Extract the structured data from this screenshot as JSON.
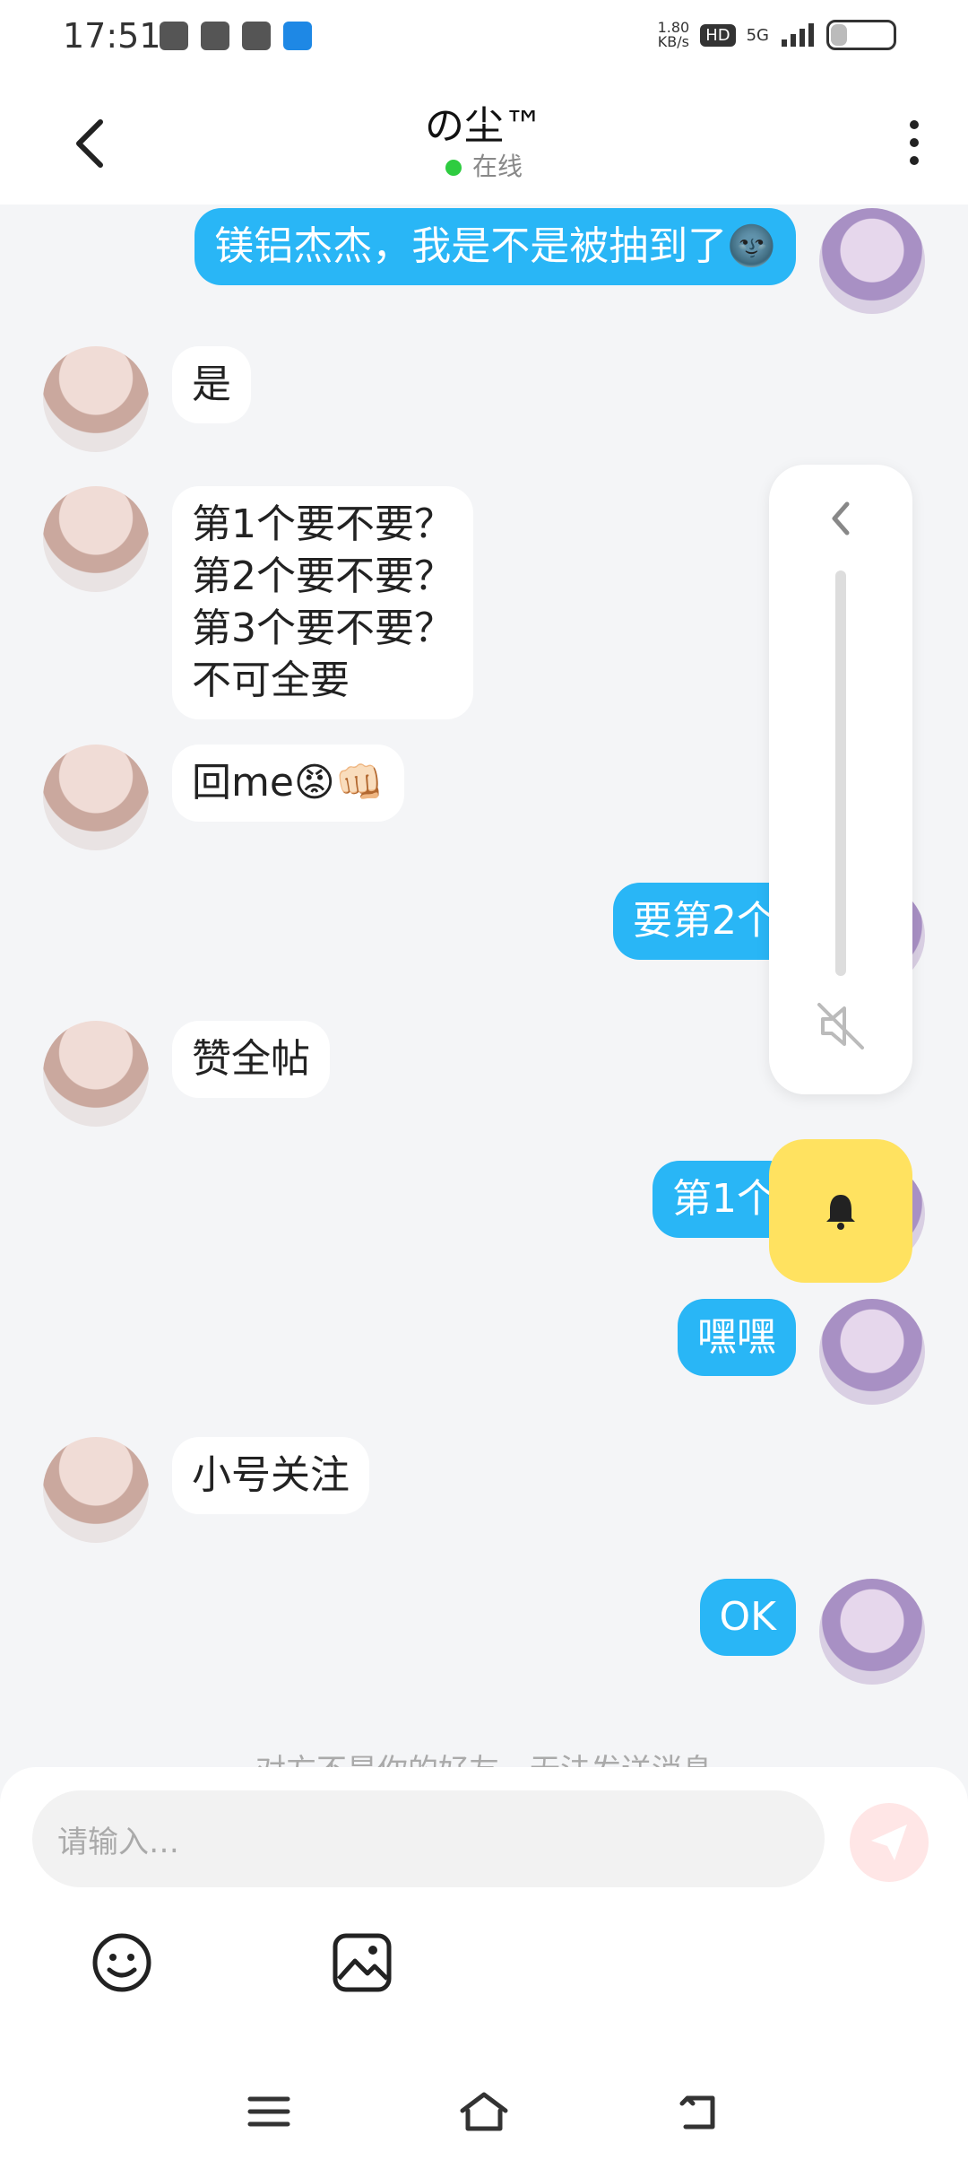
{
  "status_bar": {
    "time": "17:51",
    "net_speed_value": "1.80",
    "net_speed_unit": "KB/s",
    "hd_label": "HD",
    "network": "5G",
    "battery": "25"
  },
  "header": {
    "title": "の尘™",
    "status": "在线"
  },
  "messages": [
    {
      "side": "me",
      "text": "镁铝杰杰，我是不是被抽到了🌚"
    },
    {
      "side": "other",
      "text": "是"
    },
    {
      "side": "other",
      "text": "第1个要不要？\n第2个要不要？\n第3个要不要？\n不可全要"
    },
    {
      "side": "other",
      "text": "回me😡👊🏻"
    },
    {
      "side": "me",
      "text": "要第2个"
    },
    {
      "side": "other",
      "text": "赞全帖"
    },
    {
      "side": "me",
      "text": "第1个"
    },
    {
      "side": "me",
      "text": "嘿嘿"
    },
    {
      "side": "other",
      "text": "小号关注"
    },
    {
      "side": "me",
      "text": "OK"
    }
  ],
  "notice": "对方不是你的好友，无法发送消息",
  "input": {
    "placeholder": "请输入…"
  },
  "colors": {
    "my_bubble": "#29b6f6",
    "other_bubble": "#ffffff",
    "background": "#f4f5f7",
    "online_dot": "#2ecc40",
    "bell_button": "#ffe260"
  }
}
